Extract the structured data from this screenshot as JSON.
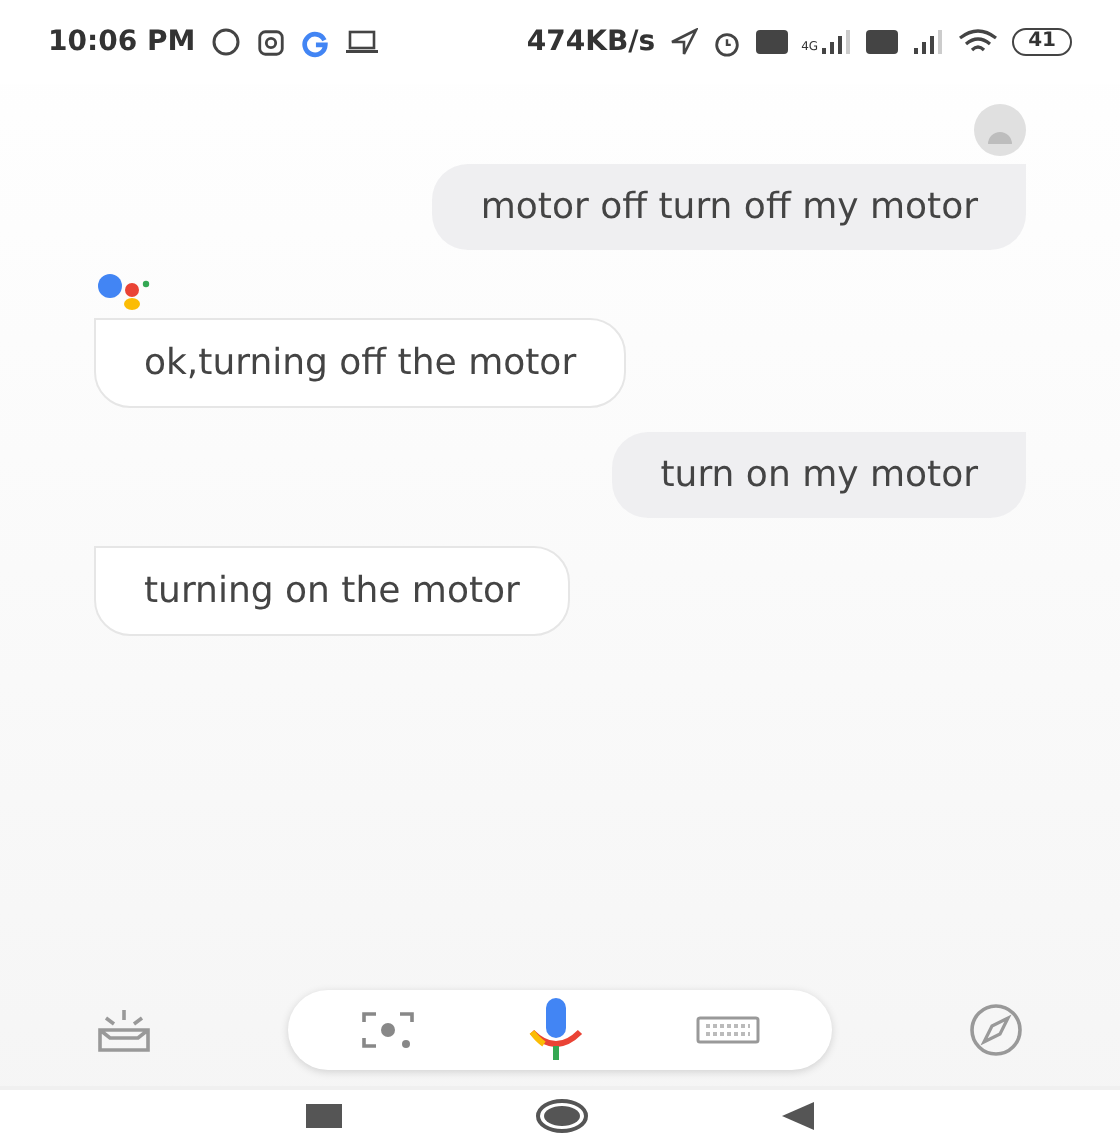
{
  "status_bar": {
    "time": "10:06 PM",
    "speed": "474KB/s",
    "network": "4G",
    "battery": "41"
  },
  "messages": [
    {
      "kind": "user",
      "text": "motor off turn off my motor"
    },
    {
      "kind": "assistant",
      "text": "ok,turning off the motor"
    },
    {
      "kind": "user",
      "text": "turn on my motor"
    },
    {
      "kind": "assistant",
      "text": "turning on the motor"
    }
  ]
}
